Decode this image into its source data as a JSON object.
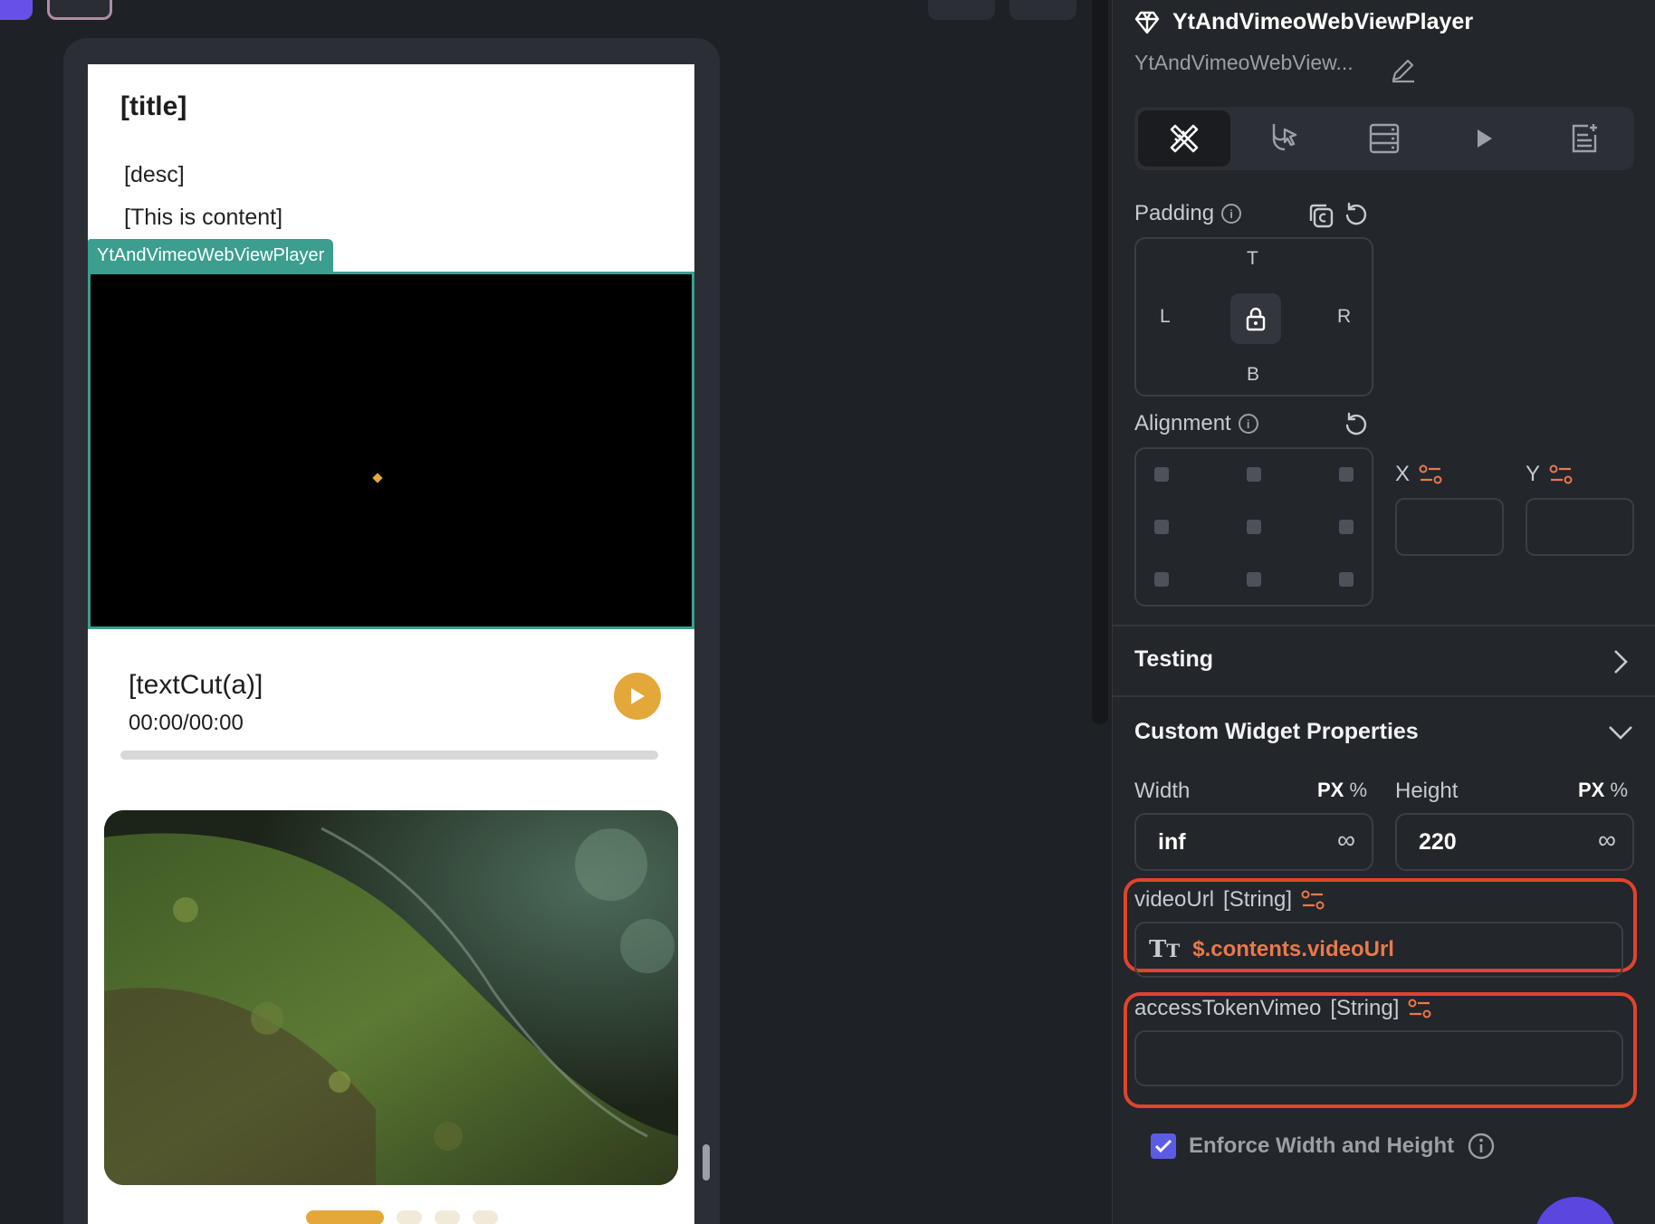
{
  "toolbar": {
    "accent": "#6750e8"
  },
  "screen": {
    "title": "[title]",
    "desc": "[desc]",
    "content": "[This is content]",
    "widget_tag": "YtAndVimeoWebViewPlayer",
    "player": {
      "name": "[textCut(a)]",
      "time": "00:00/00:00",
      "progress": 0
    },
    "carousel": {
      "pages": 4,
      "active_index": 0
    }
  },
  "panel": {
    "title": "YtAndVimeoWebViewPlayer",
    "subtitle": "YtAndVimeoWebView...",
    "tabs": [
      "properties-icon",
      "actions-icon",
      "backend-query-icon",
      "run-icon",
      "documentation-icon"
    ],
    "padding": {
      "label": "Padding",
      "top": "T",
      "left": "L",
      "right": "R",
      "bottom": "B"
    },
    "alignment": {
      "label": "Alignment",
      "x_label": "X",
      "y_label": "Y"
    },
    "testing_label": "Testing",
    "custom_props_label": "Custom Widget Properties",
    "width": {
      "label": "Width",
      "unit": "PX",
      "alt_unit": "%",
      "value": "inf",
      "inf": "∞"
    },
    "height": {
      "label": "Height",
      "unit": "PX",
      "alt_unit": "%",
      "value": "220",
      "inf": "∞"
    },
    "video_url": {
      "label": "videoUrl",
      "type": "[String]",
      "value": "$.contents.videoUrl"
    },
    "access_token": {
      "label": "accessTokenVimeo",
      "type": "[String]",
      "value": ""
    },
    "enforce_label": "Enforce Width and Height"
  },
  "colors": {
    "accent_orange": "#e4a73a",
    "highlight_red": "#e0442b",
    "teal": "#3b9e8f",
    "binding_orange": "#e9794b",
    "check_purple": "#5b5ce6"
  }
}
